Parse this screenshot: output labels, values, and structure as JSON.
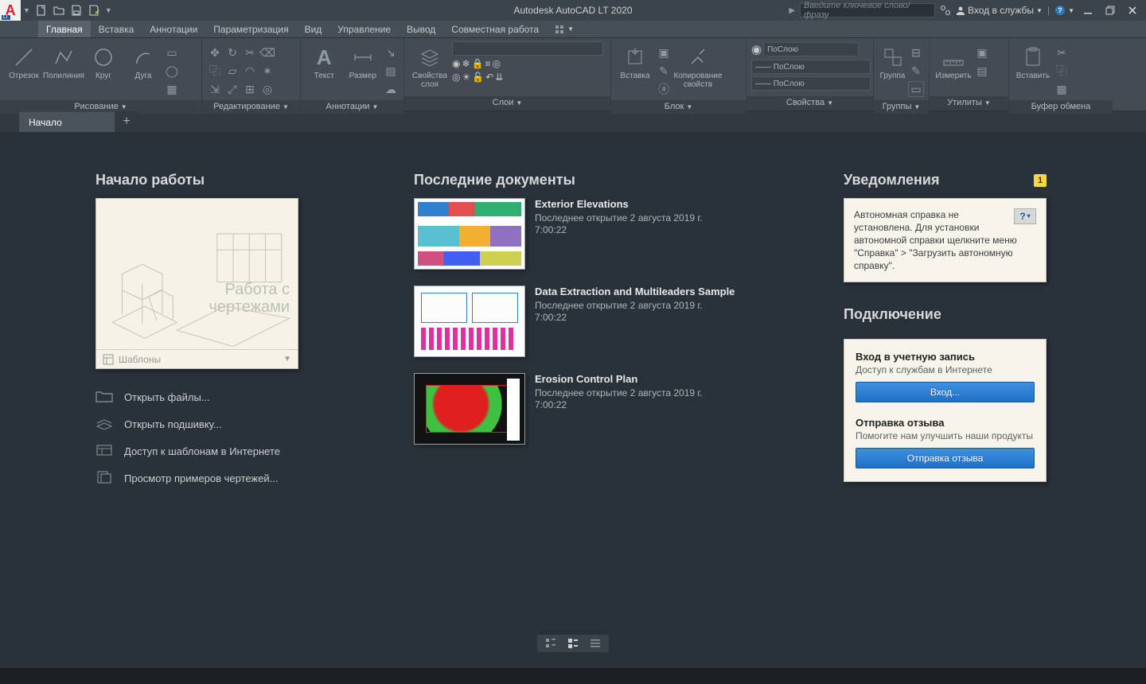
{
  "title": "Autodesk AutoCAD LT 2020",
  "search_placeholder": "Введите ключевое слово/фразу",
  "signin_label": "Вход в службы",
  "tabs": [
    "Главная",
    "Вставка",
    "Аннотации",
    "Параметризация",
    "Вид",
    "Управление",
    "Вывод",
    "Совместная работа"
  ],
  "ribbon": {
    "draw": {
      "title": "Рисование",
      "btns": [
        "Отрезок",
        "Полилиния",
        "Круг",
        "Дуга"
      ]
    },
    "edit": {
      "title": "Редактирование"
    },
    "annot": {
      "title": "Аннотации",
      "btns": [
        "Текст",
        "Размер"
      ]
    },
    "layers": {
      "title": "Слои",
      "btn": "Свойства\nслоя"
    },
    "block": {
      "title": "Блок",
      "btns": [
        "Вставка",
        "Копирование\nсвойств"
      ]
    },
    "props": {
      "title": "Свойства",
      "rows": [
        "ПоСлою",
        "—— ПоСлою",
        "—— ПоСлою"
      ]
    },
    "groups": {
      "title": "Группы",
      "btn": "Группа"
    },
    "utils": {
      "title": "Утилиты",
      "btn": "Измерить"
    },
    "clip": {
      "title": "Буфер обмена",
      "btn": "Вставить"
    }
  },
  "file_tab": "Начало",
  "start": {
    "getting_started": "Начало работы",
    "card_lines": [
      "Работа с",
      "чертежами"
    ],
    "card_templates": "Шаблоны",
    "links": [
      "Открыть файлы...",
      "Открыть подшивку...",
      "Доступ к шаблонам в Интернете",
      "Просмотр примеров чертежей..."
    ]
  },
  "recent": {
    "title": "Последние документы",
    "docs": [
      {
        "name": "Exterior Elevations",
        "ts1": "Последнее открытие 2 августа 2019 г.",
        "ts2": "7:00:22"
      },
      {
        "name": "Data Extraction and Multileaders Sample",
        "ts1": "Последнее открытие 2 августа 2019 г.",
        "ts2": "7:00:22"
      },
      {
        "name": "Erosion Control Plan",
        "ts1": "Последнее открытие 2 августа 2019 г.",
        "ts2": "7:00:22"
      }
    ]
  },
  "notif": {
    "title": "Уведомления",
    "badge": "1",
    "body": "Автономная справка не установлена. Для установки автономной справки щелкните меню \"Справка\" > \"Загрузить автономную справку\"."
  },
  "connect": {
    "title": "Подключение",
    "acc_hd": "Вход в учетную запись",
    "acc_sub": "Доступ к службам в Интернете",
    "signin_btn": "Вход...",
    "fb_hd": "Отправка отзыва",
    "fb_sub": "Помогите нам улучшить наши продукты",
    "fb_btn": "Отправка отзыва"
  }
}
